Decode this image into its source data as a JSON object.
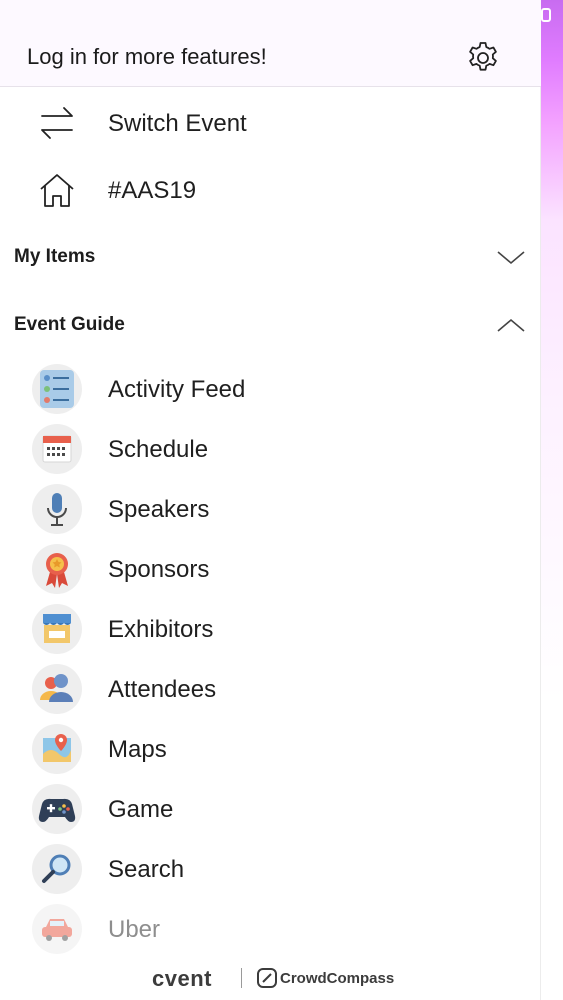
{
  "header": {
    "login_prompt": "Log in for more features!"
  },
  "top_items": [
    {
      "label": "Switch Event",
      "icon": "switch-arrows-icon"
    },
    {
      "label": "#AAS19",
      "icon": "home-icon"
    }
  ],
  "sections": {
    "my_items": {
      "title": "My Items",
      "state": "collapsed"
    },
    "event_guide": {
      "title": "Event Guide",
      "state": "expanded"
    }
  },
  "event_guide_items": [
    {
      "label": "Activity Feed",
      "icon": "activity-feed-icon"
    },
    {
      "label": "Schedule",
      "icon": "calendar-icon"
    },
    {
      "label": "Speakers",
      "icon": "microphone-icon"
    },
    {
      "label": "Sponsors",
      "icon": "ribbon-badge-icon"
    },
    {
      "label": "Exhibitors",
      "icon": "booth-icon"
    },
    {
      "label": "Attendees",
      "icon": "people-icon"
    },
    {
      "label": "Maps",
      "icon": "map-icon"
    },
    {
      "label": "Game",
      "icon": "gamepad-icon"
    },
    {
      "label": "Search",
      "icon": "magnifier-icon"
    },
    {
      "label": "Uber",
      "icon": "car-icon"
    }
  ],
  "footer": {
    "brand_primary": "cvent",
    "brand_secondary": "CrowdCompass"
  },
  "colors": {
    "header_bg": "#fdf9ff",
    "accent_strip": "#e07cff"
  }
}
